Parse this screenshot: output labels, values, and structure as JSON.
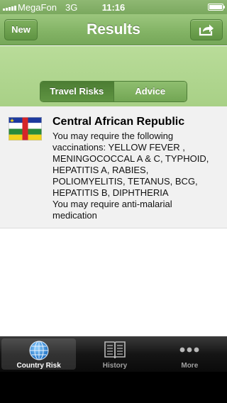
{
  "status_bar": {
    "carrier": "MegaFon",
    "network": "3G",
    "time": "11:16"
  },
  "navbar": {
    "title": "Results",
    "new_label": "New",
    "share_icon": "share-icon"
  },
  "segments": {
    "items": [
      "Travel Risks",
      "Advice"
    ],
    "selected": "Travel Risks"
  },
  "result": {
    "country": "Central African Republic",
    "flag_icon": "central-african-republic-flag",
    "lines": [
      "You may require the following",
      "vaccinations: YELLOW FEVER ,",
      "MENINGOCOCCAL A & C, TYPHOID,",
      "HEPATITIS A, RABIES,",
      "POLIOMYELITIS, TETANUS, BCG,",
      "HEPATITIS B, DIPHTHERIA",
      "You may require anti-malarial",
      "medication"
    ]
  },
  "tabbar": {
    "items": [
      {
        "label": "Country Risk",
        "icon": "globe-icon",
        "active": true
      },
      {
        "label": "History",
        "icon": "book-icon",
        "active": false
      },
      {
        "label": "More",
        "icon": "more-dots-icon",
        "active": false
      }
    ]
  },
  "colors": {
    "header_green": "#84b466",
    "segment_bg": "#b0d48f",
    "content_bg": "#f1f1f1",
    "tabbar": "#151515"
  }
}
